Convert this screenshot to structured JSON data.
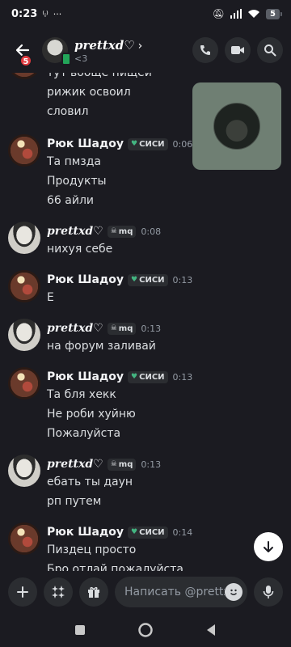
{
  "status": {
    "time": "0:23",
    "battery": "5"
  },
  "header": {
    "name": "prettxd♡",
    "status_text": "<3",
    "badge": "5",
    "chevron": "›"
  },
  "messages": {
    "top": {
      "line1": "тут вооще пищеи",
      "line2": "рижик освоил",
      "line3": "словил"
    },
    "g1": {
      "user": "Рюк Шадоу",
      "tag": "СИСИ",
      "time": "0:06",
      "l1": "Та пмзда",
      "l2": "Продукты",
      "l3": "66 айли"
    },
    "g2": {
      "user": "prettxd♡",
      "tag": "mq",
      "time": "0:08",
      "l1": "нихуя себе"
    },
    "g3": {
      "user": "Рюк Шадоу",
      "tag": "СИСИ",
      "time": "0:13",
      "l1": "Е"
    },
    "g4": {
      "user": "prettxd♡",
      "tag": "mq",
      "time": "0:13",
      "l1": "на форум заливай"
    },
    "g5": {
      "user": "Рюк Шадоу",
      "tag": "СИСИ",
      "time": "0:13",
      "l1": "Та бля хекк",
      "l2": "Не роби хуйню",
      "l3": "Пожалуйста"
    },
    "g6": {
      "user": "prettxd♡",
      "tag": "mq",
      "time": "0:13",
      "l1": "ебать ты даун",
      "l2": "рп путем"
    },
    "g7": {
      "user": "Рюк Шадоу",
      "tag": "СИСИ",
      "time": "0:14",
      "l1": "Пиздец просто",
      "l2": "Бро отлай пожалуйста"
    }
  },
  "input": {
    "placeholder": "Написать @prettxd♡"
  },
  "colors": {
    "background": "#1b1b21",
    "badge_red": "#e0393e",
    "online_green": "#23a559",
    "tag_bg": "#2b2d31"
  }
}
